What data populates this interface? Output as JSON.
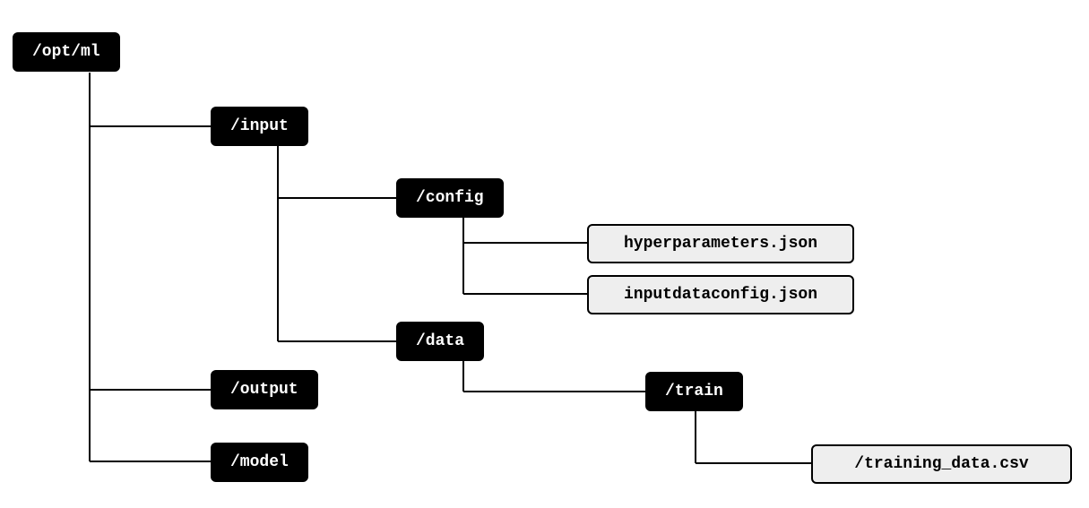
{
  "nodes": {
    "root": {
      "label": "/opt/ml"
    },
    "input": {
      "label": "/input"
    },
    "config": {
      "label": "/config"
    },
    "hyper": {
      "label": "hyperparameters.json"
    },
    "idc": {
      "label": "inputdataconfig.json"
    },
    "data": {
      "label": "/data"
    },
    "train": {
      "label": "/train"
    },
    "csv": {
      "label": "/training_data.csv"
    },
    "output": {
      "label": "/output"
    },
    "model": {
      "label": "/model"
    }
  }
}
